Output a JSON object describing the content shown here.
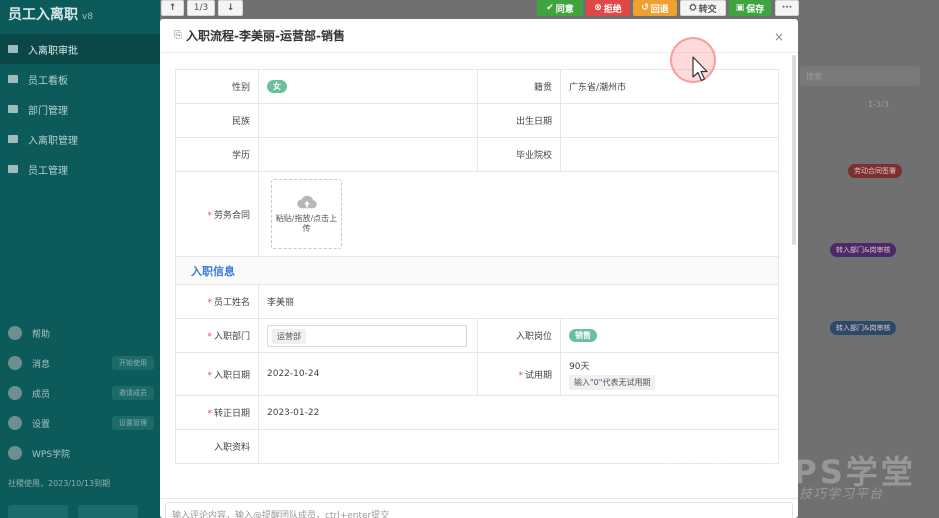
{
  "app": {
    "title": "员工入离职",
    "subtitle": "v8"
  },
  "sidebar": {
    "items": [
      {
        "label": "入离职审批",
        "active": true
      },
      {
        "label": "员工看板",
        "active": false
      },
      {
        "label": "部门管理",
        "active": false
      },
      {
        "label": "入离职管理",
        "active": false
      },
      {
        "label": "员工管理",
        "active": false
      }
    ],
    "bottom_items": [
      {
        "label": "帮助",
        "pill": ""
      },
      {
        "label": "消息",
        "pill": "开始使用"
      },
      {
        "label": "成员",
        "pill": "邀请成员"
      },
      {
        "label": "设置",
        "pill": "设置管理"
      },
      {
        "label": "WPS学院",
        "pill": ""
      }
    ],
    "footer_note": "社稷使用，2023/10/13到期"
  },
  "background": {
    "search_placeholder": "搜索",
    "pager": "1-3/3",
    "badges": [
      {
        "text": "劳动合同签署",
        "color": "#7a3030"
      },
      {
        "text": "转入部门&岗审核",
        "color": "#4a2a6a"
      },
      {
        "text": "转入部门&岗审核",
        "color": "#2a4a6a"
      }
    ]
  },
  "toolbar": {
    "up_icon": "arrow-up-icon",
    "counter": "1/3",
    "down_icon": "arrow-down-icon",
    "agree": "同意",
    "reject": "拒绝",
    "rollback": "回退",
    "transfer": "转交",
    "save": "保存",
    "more": "···",
    "colors": {
      "agree": "#3fa33f",
      "reject": "#e04848",
      "rollback": "#f0a030",
      "save": "#3fa33f"
    }
  },
  "modal": {
    "title": "入职流程-李美丽-运营部-销售",
    "close": "×"
  },
  "form": {
    "gender_label": "性别",
    "gender_value": "女",
    "native_label": "籍贯",
    "native_value": "广东省/潮州市",
    "ethnic_label": "民族",
    "ethnic_value": "",
    "birth_label": "出生日期",
    "birth_value": "",
    "education_label": "学历",
    "education_value": "",
    "school_label": "毕业院校",
    "school_value": "",
    "contract_label": "劳务合同",
    "upload_text": "粘贴/拖放/点击上传",
    "section_title": "入职信息",
    "name_label": "员工姓名",
    "name_value": "李美丽",
    "dept_label": "入职部门",
    "dept_value": "运营部",
    "post_label": "入职岗位",
    "post_value": "销售",
    "date_label": "入职日期",
    "date_value": "2022-10-24",
    "trial_label": "试用期",
    "trial_value": "90天",
    "trial_hint": "输入\"0\"代表无试用期",
    "regular_label": "转正日期",
    "regular_value": "2023-01-22",
    "docs_label": "入职资料",
    "docs_value": ""
  },
  "comment": {
    "placeholder": "输入评论内容，输入@提醒团队成员，ctrl+enter提交"
  },
  "watermark": {
    "brand": "WPS学堂",
    "sub": "Office技巧学习平台"
  }
}
